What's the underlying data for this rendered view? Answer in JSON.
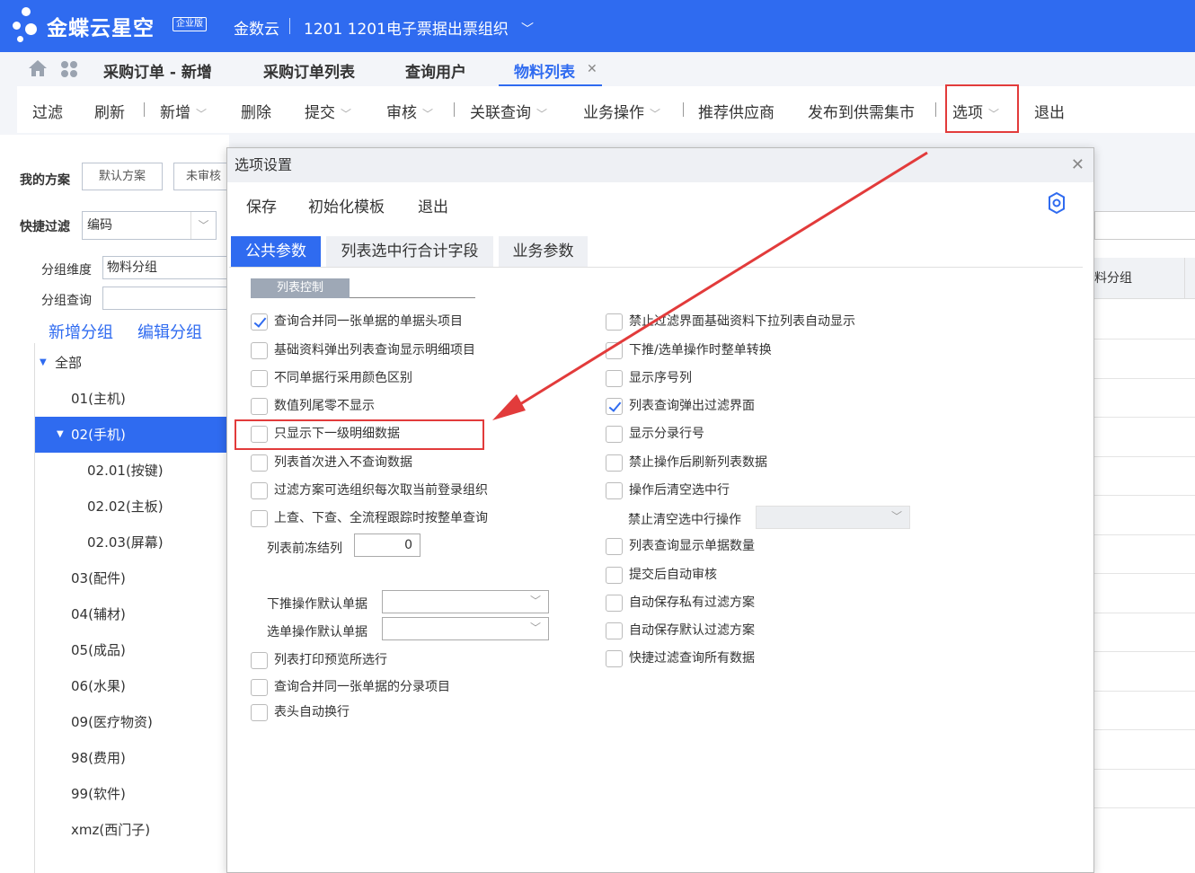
{
  "app": {
    "brand": "金蝶云星空",
    "edition": "企业版",
    "org_primary": "金数云",
    "org_secondary": "1201 1201电子票据出票组织"
  },
  "tabs": [
    {
      "label": "采购订单 - 新增"
    },
    {
      "label": "采购订单列表"
    },
    {
      "label": "查询用户"
    },
    {
      "label": "物料列表",
      "active": true
    }
  ],
  "toolbar": {
    "filter": "过滤",
    "refresh": "刷新",
    "add": "新增",
    "delete": "删除",
    "submit": "提交",
    "audit": "审核",
    "related": "关联查询",
    "business": "业务操作",
    "recommend": "推荐供应商",
    "publish": "发布到供需集市",
    "options": "选项",
    "exit": "退出"
  },
  "left": {
    "my_scheme_label": "我的方案",
    "scheme_default": "默认方案",
    "scheme_unaudited": "未审核",
    "quick_filter_label": "快捷过滤",
    "quick_filter_value": "编码",
    "group_dim_label": "分组维度",
    "group_dim_value": "物料分组",
    "group_query_label": "分组查询",
    "add_group": "新增分组",
    "edit_group": "编辑分组",
    "tree": [
      {
        "label": "全部",
        "level": 0,
        "expanded": true
      },
      {
        "label": "01(主机)",
        "level": 1
      },
      {
        "label": "02(手机)",
        "level": 1,
        "expanded": true,
        "selected": true
      },
      {
        "label": "02.01(按键)",
        "level": 2
      },
      {
        "label": "02.02(主板)",
        "level": 2
      },
      {
        "label": "02.03(屏幕)",
        "level": 2
      },
      {
        "label": "03(配件)",
        "level": 1
      },
      {
        "label": "04(辅材)",
        "level": 1
      },
      {
        "label": "05(成品)",
        "level": 1
      },
      {
        "label": "06(水果)",
        "level": 1
      },
      {
        "label": "09(医疗物资)",
        "level": 1
      },
      {
        "label": "98(费用)",
        "level": 1
      },
      {
        "label": "99(软件)",
        "level": 1
      },
      {
        "label": "xmz(西门子)",
        "level": 1
      }
    ]
  },
  "grid": {
    "header_partial": "料分组"
  },
  "dialog": {
    "title": "选项设置",
    "toolbar": {
      "save": "保存",
      "init_template": "初始化模板",
      "exit": "退出"
    },
    "tabs": [
      {
        "label": "公共参数",
        "active": true
      },
      {
        "label": "列表选中行合计字段"
      },
      {
        "label": "业务参数"
      }
    ],
    "section": "列表控制",
    "left_options": [
      {
        "label": "查询合并同一张单据的单据头项目",
        "checked": true
      },
      {
        "label": "基础资料弹出列表查询显示明细项目",
        "checked": false
      },
      {
        "label": "不同单据行采用颜色区别",
        "checked": false
      },
      {
        "label": "数值列尾零不显示",
        "checked": false
      },
      {
        "label": "只显示下一级明细数据",
        "checked": false
      },
      {
        "label": "列表首次进入不查询数据",
        "checked": false
      },
      {
        "label": "过滤方案可选组织每次取当前登录组织",
        "checked": false
      },
      {
        "label": "上查、下查、全流程跟踪时按整单查询",
        "checked": false
      }
    ],
    "freeze_label": "列表前冻结列",
    "freeze_value": "0",
    "push_default_label": "下推操作默认单据",
    "select_default_label": "选单操作默认单据",
    "left_options_bottom": [
      {
        "label": "列表打印预览所选行",
        "checked": false
      },
      {
        "label": "查询合并同一张单据的分录项目",
        "checked": false
      },
      {
        "label": "表头自动换行",
        "checked": false
      }
    ],
    "right_options": [
      {
        "label": "禁止过滤界面基础资料下拉列表自动显示",
        "checked": false
      },
      {
        "label": "下推/选单操作时整单转换",
        "checked": false
      },
      {
        "label": "显示序号列",
        "checked": false
      },
      {
        "label": "列表查询弹出过滤界面",
        "checked": true
      },
      {
        "label": "显示分录行号",
        "checked": false
      },
      {
        "label": "禁止操作后刷新列表数据",
        "checked": false
      },
      {
        "label": "操作后清空选中行",
        "checked": false
      }
    ],
    "forbid_clear_label": "禁止清空选中行操作",
    "right_options_bottom": [
      {
        "label": "列表查询显示单据数量",
        "checked": false
      },
      {
        "label": "提交后自动审核",
        "checked": false
      },
      {
        "label": "自动保存私有过滤方案",
        "checked": false
      },
      {
        "label": "自动保存默认过滤方案",
        "checked": false
      },
      {
        "label": "快捷过滤查询所有数据",
        "checked": false
      }
    ]
  },
  "colors": {
    "accent": "#2f6bf0",
    "highlight": "#e23b3b"
  }
}
